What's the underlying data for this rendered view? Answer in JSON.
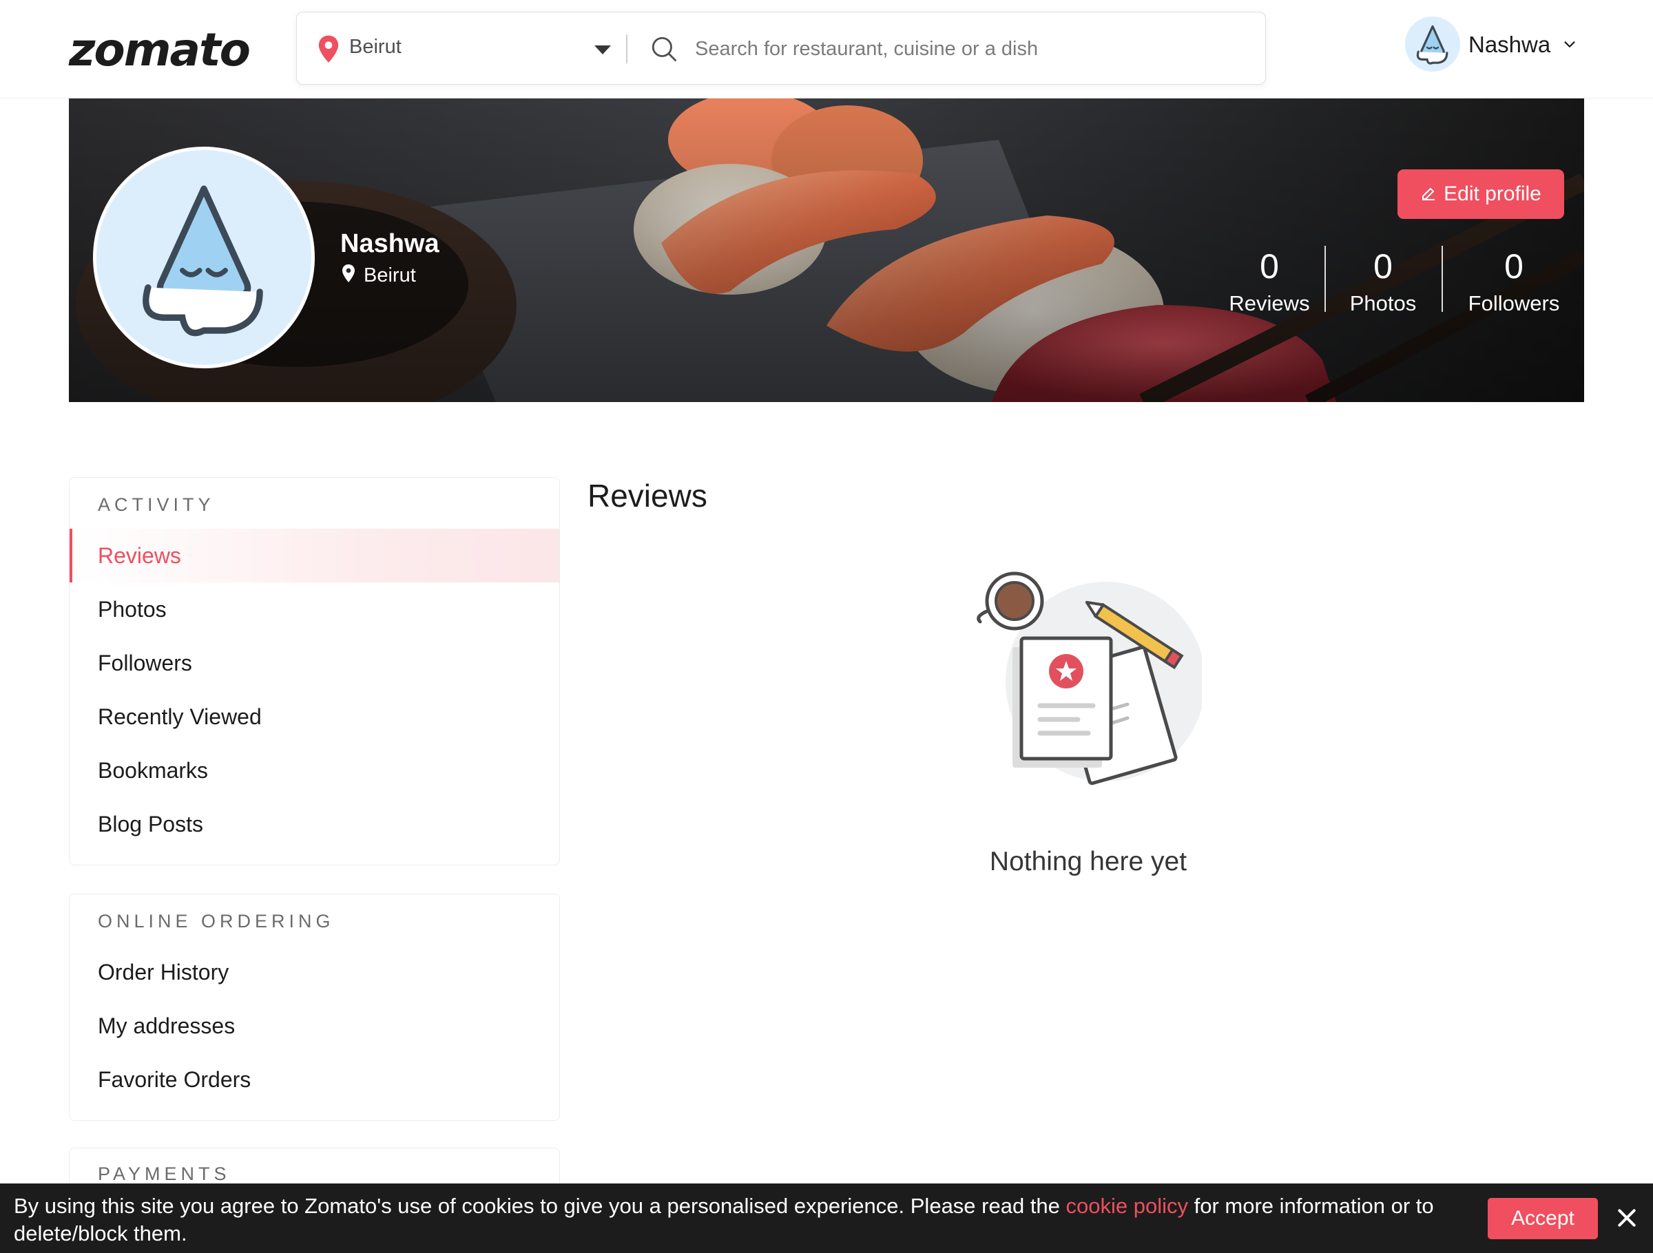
{
  "header": {
    "logo": "zomato",
    "location": "Beirut",
    "search_placeholder": "Search for restaurant, cuisine or a dish",
    "user_name": "Nashwa"
  },
  "profile": {
    "name": "Nashwa",
    "location": "Beirut",
    "edit_label": "Edit profile",
    "stats": [
      {
        "value": "0",
        "label": "Reviews"
      },
      {
        "value": "0",
        "label": "Photos"
      },
      {
        "value": "0",
        "label": "Followers"
      }
    ]
  },
  "sidebar": {
    "activity": {
      "title": "ACTIVITY",
      "items": [
        "Reviews",
        "Photos",
        "Followers",
        "Recently Viewed",
        "Bookmarks",
        "Blog Posts"
      ],
      "active": "Reviews"
    },
    "online_ordering": {
      "title": "ONLINE ORDERING",
      "items": [
        "Order History",
        "My addresses",
        "Favorite Orders"
      ]
    },
    "payments": {
      "title": "PAYMENTS"
    }
  },
  "main": {
    "title": "Reviews",
    "empty_text": "Nothing here yet"
  },
  "cookie": {
    "text_before": "By using this site you agree to Zomato's use of cookies to give you a personalised experience. Please read the ",
    "link": "cookie policy",
    "text_after": " for more information or to delete/block them.",
    "accept": "Accept"
  },
  "colors": {
    "accent": "#ef4f5f",
    "text": "#1c1c1c",
    "avatar_bg": "#dceefb",
    "cookie_bar": "#1c1c1c"
  }
}
